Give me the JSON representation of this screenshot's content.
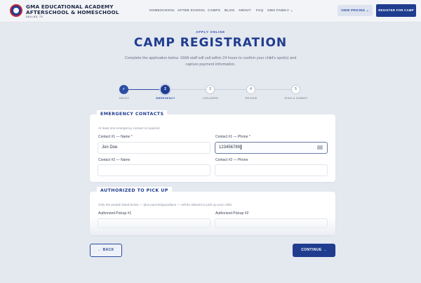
{
  "nav": {
    "brand_line1": "GMA EDUCATIONAL ACADEMY",
    "brand_line2": "AFTERSCHOOL & HOMESCHOOL",
    "brand_location": "DALLAS, TX",
    "links": [
      "HOMESCHOOL",
      "AFTER SCHOOL",
      "CAMPS",
      "BLOG",
      "ABOUT",
      "FAQ",
      "GMA FAMILY"
    ],
    "family_chevron": "⌄",
    "view_pricing": "VIEW PRICING",
    "pricing_chevron": "⌄",
    "register": "REGISTER FOR CAMP"
  },
  "hero": {
    "eyebrow": "APPLY ONLINE",
    "title": "CAMP REGISTRATION",
    "intro": "Complete the application below. GMA staff will call within 24 hours to confirm your child's spot(s) and capture payment information."
  },
  "stepper": {
    "steps": [
      {
        "number": "✓",
        "label": "ABOUT",
        "state": "done"
      },
      {
        "number": "2",
        "label": "EMERGENCY",
        "state": "active"
      },
      {
        "number": "3",
        "label": "CHILDREN",
        "state": "todo"
      },
      {
        "number": "4",
        "label": "REVIEW",
        "state": "todo"
      },
      {
        "number": "5",
        "label": "SIGN & SUBMIT",
        "state": "todo"
      }
    ]
  },
  "emergency": {
    "heading": "EMERGENCY CONTACTS",
    "help": "At least one emergency contact is required.",
    "contact1_name_label": "Contact #1 — Name",
    "contact1_name_value": "Jon Doe",
    "contact1_phone_label": "Contact #1 — Phone",
    "contact1_phone_value": "123456789",
    "contact2_name_label": "Contact #2 — Name",
    "contact2_name_value": "",
    "contact2_phone_label": "Contact #2 — Phone",
    "contact2_phone_value": "",
    "required_mark": "*"
  },
  "pickup": {
    "heading": "AUTHORIZED TO PICK UP",
    "help": "Only the people listed below — plus parents/guardians — will be allowed to pick up your child.",
    "pickup1_label": "Authorized Pickup #1",
    "pickup2_label": "Authorized Pickup #2"
  },
  "actions": {
    "back": "← BACK",
    "continue": "CONTINUE →"
  },
  "colors": {
    "brand_blue": "#1f3c8f",
    "accent_red": "#c8283b",
    "page_bg": "#e4e8ef"
  }
}
